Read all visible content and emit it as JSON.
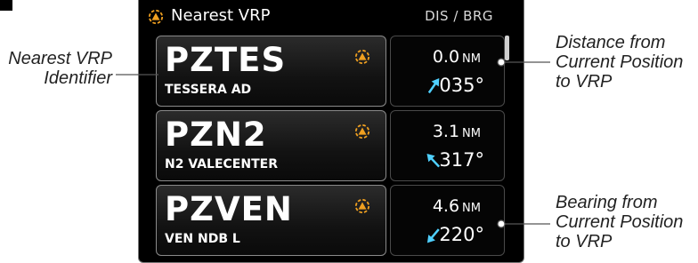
{
  "header": {
    "title": "Nearest VRP",
    "columns": "DIS / BRG"
  },
  "rows": [
    {
      "ident": "PZTES",
      "name": "TESSERA AD",
      "distance": "0.0",
      "unit": "NM",
      "bearing": "035°",
      "arrow_bearing_deg": 35
    },
    {
      "ident": "PZN2",
      "name": "N2 VALECENTER",
      "distance": "3.1",
      "unit": "NM",
      "bearing": "317°",
      "arrow_bearing_deg": 317
    },
    {
      "ident": "PZVEN",
      "name": "VEN NDB L",
      "distance": "4.6",
      "unit": "NM",
      "bearing": "220°",
      "arrow_bearing_deg": 220
    }
  ],
  "callouts": {
    "identifier": [
      "Nearest VRP",
      "Identifier"
    ],
    "distance": [
      "Distance from",
      "Current Position",
      "to VRP"
    ],
    "bearing": [
      "Bearing from",
      "Current Position",
      "to VRP"
    ]
  },
  "colors": {
    "vrp_icon": "#f0a020",
    "bearing_arrow": "#4fd0ff"
  }
}
